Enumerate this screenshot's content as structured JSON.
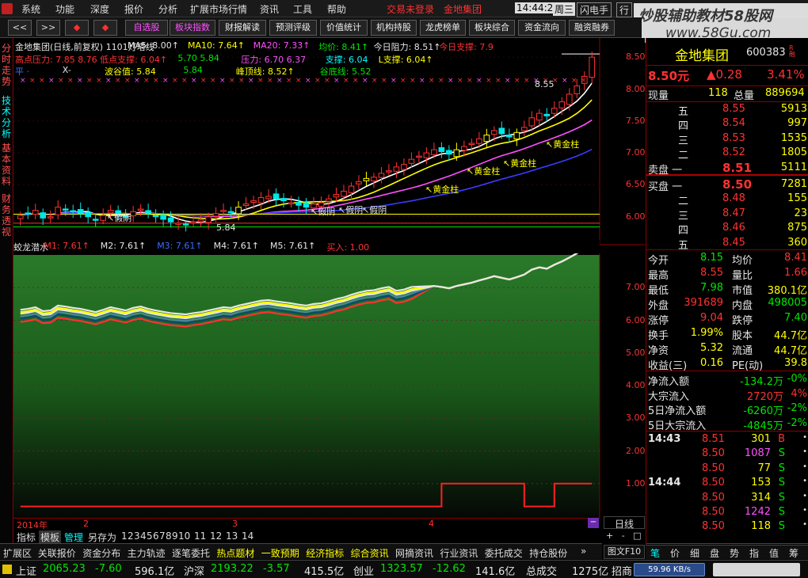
{
  "menu": [
    "系统",
    "功能",
    "深度",
    "报价",
    "分析",
    "扩展市场行情",
    "资讯",
    "工具",
    "帮助"
  ],
  "menu_status": {
    "login": "交易未登录",
    "stock": "金地集团",
    "clock": "14:44:29",
    "weekday": "周三",
    "flash": "闪电手",
    "more": "行"
  },
  "watermark": {
    "title": "炒股辅助教材58股网",
    "url": "www.58Gu.com"
  },
  "nav_buttons": [
    "<<",
    ">>",
    "◆",
    "◆"
  ],
  "toolbar": [
    "自选股",
    "板块指数",
    "财报解读",
    "预测评级",
    "价值统计",
    "机构持股",
    "龙虎榜单",
    "板块综合",
    "资金流向",
    "融资融券"
  ],
  "side_tabs": [
    "分时走势",
    "技术分析",
    "基本资料",
    "财务透视"
  ],
  "main_chart": {
    "header": [
      {
        "t": "金地集团(日线,前复权) 1101灯塔线",
        "c": "#e6e6e6"
      },
      {
        "t": "MA5: 8.00↑",
        "c": "#e6e6e6"
      },
      {
        "t": "MA10: 7.64↑",
        "c": "#ffff00"
      },
      {
        "t": "MA20: 7.33↑",
        "c": "#ff50ff"
      },
      {
        "t": "均价: 8.41↑",
        "c": "#00e600"
      },
      {
        "t": "今日阻力: 8.51↑",
        "c": "#e6e6e6"
      },
      {
        "t": "今日支撑: 7.9",
        "c": "#ff3232"
      }
    ],
    "header2": [
      {
        "t": "高点压力: 7.85  8.76  低点支撑: 6.04↑",
        "c": "#ff3232"
      },
      {
        "t": "5.70  5.84",
        "c": "#00e600"
      },
      {
        "t": "压力: 6.70  6.37",
        "c": "#ff50ff"
      },
      {
        "t": "支撑: 6.04",
        "c": "#00ffff"
      },
      {
        "t": "L支撑: 6.04↑",
        "c": "#ffff00"
      }
    ],
    "header3": [
      {
        "t": "平 ·",
        "c": "#3b6cff"
      },
      {
        "t": "X-",
        "c": "#e6e6e6"
      },
      {
        "t": "波谷值: 5.84",
        "c": "#ffff00"
      },
      {
        "t": "5.84",
        "c": "#00e600"
      },
      {
        "t": "峰顶线: 8.52↑",
        "c": "#ffff00"
      },
      {
        "t": "谷底线: 5.52",
        "c": "#00e600"
      }
    ],
    "y_labels": [
      "8.50",
      "8.00",
      "7.50",
      "7.00",
      "6.50",
      "6.00"
    ],
    "annotations": [
      "黄金柱",
      "黄金柱",
      "黄金柱",
      "黄金柱",
      "假阴",
      "假阴",
      "假阴",
      "假阴",
      "8.55",
      "5.84"
    ]
  },
  "sub_chart": {
    "header": [
      {
        "t": "蛟龙潜水",
        "c": "#e6e6e6"
      },
      {
        "t": "M1: 7.61↑",
        "c": "#ff3232"
      },
      {
        "t": "M2: 7.61↑",
        "c": "#e6e6e6"
      },
      {
        "t": "M3: 7.61↑",
        "c": "#3b6cff"
      },
      {
        "t": "M4: 7.61↑",
        "c": "#e6e6e6"
      },
      {
        "t": "M5: 7.61↑",
        "c": "#e6e6e6"
      },
      {
        "t": "买入: 1.00",
        "c": "#ff3232"
      }
    ],
    "y_labels": [
      "7.00",
      "6.00",
      "5.00",
      "4.00",
      "3.00",
      "2.00",
      "1.00"
    ]
  },
  "x_axis": [
    "2014年",
    "2",
    "3",
    "4"
  ],
  "period_label": "日线",
  "chart_tabs": [
    "指标",
    "模板",
    "管理",
    "另存为",
    "1",
    "2",
    "3",
    "4",
    "5",
    "6",
    "7",
    "8",
    "9",
    "10",
    "11",
    "12",
    "13",
    "14"
  ],
  "quote": {
    "name": "金地集团",
    "code": "600383",
    "price": "8.50元",
    "change": "▲0.28",
    "pct": "3.41%",
    "now_vol_label": "现量",
    "now_vol": "118",
    "total_label": "总量",
    "total": "889694",
    "asks": [
      {
        "l": "五",
        "p": "8.55",
        "v": "5913"
      },
      {
        "l": "四",
        "p": "8.54",
        "v": "997"
      },
      {
        "l": "三",
        "p": "8.53",
        "v": "1535"
      },
      {
        "l": "二",
        "p": "8.52",
        "v": "1805"
      },
      {
        "l": "卖盘 一",
        "p": "8.51",
        "v": "5111"
      }
    ],
    "bids": [
      {
        "l": "买盘 一",
        "p": "8.50",
        "v": "7281"
      },
      {
        "l": "二",
        "p": "8.48",
        "v": "155"
      },
      {
        "l": "三",
        "p": "8.47",
        "v": "23"
      },
      {
        "l": "四",
        "p": "8.46",
        "v": "875"
      },
      {
        "l": "五",
        "p": "8.45",
        "v": "360"
      }
    ],
    "stats": [
      {
        "a": "今开",
        "b": "8.15",
        "c": "均价",
        "d": "8.41",
        "bc": "#00e600",
        "dc": "#ff3232"
      },
      {
        "a": "最高",
        "b": "8.55",
        "c": "量比",
        "d": "1.66",
        "bc": "#ff3232",
        "dc": "#ff3232"
      },
      {
        "a": "最低",
        "b": "7.98",
        "c": "市值",
        "d": "380.1亿",
        "bc": "#00e600",
        "dc": "#ffff00"
      },
      {
        "a": "外盘",
        "b": "391689",
        "c": "内盘",
        "d": "498005",
        "bc": "#ff3232",
        "dc": "#00e600"
      },
      {
        "a": "涨停",
        "b": "9.04",
        "c": "跌停",
        "d": "7.40",
        "bc": "#ff3232",
        "dc": "#00e600"
      },
      {
        "a": "换手",
        "b": "1.99%",
        "c": "股本",
        "d": "44.7亿",
        "bc": "#ffff00",
        "dc": "#ffff00"
      },
      {
        "a": "净资",
        "b": "5.32",
        "c": "流通",
        "d": "44.7亿",
        "bc": "#ffff00",
        "dc": "#ffff00"
      },
      {
        "a": "收益(三)",
        "b": "0.16",
        "c": "PE(动)",
        "d": "39.8",
        "bc": "#ffff00",
        "dc": "#ffff00"
      }
    ],
    "flows": [
      {
        "a": "净流入额",
        "b": "-134.2万",
        "c": "-0%"
      },
      {
        "a": "大宗流入",
        "b": "2720万",
        "c": "4%"
      },
      {
        "a": "5日净流入额",
        "b": "-6260万",
        "c": "-2%"
      },
      {
        "a": "5日大宗流入",
        "b": "-4845万",
        "c": "-2%"
      }
    ],
    "ticks": [
      {
        "t": "14:43",
        "p": "8.51",
        "v": "301",
        "s": "B",
        "vc": "#ffff00",
        "sc": "#ff3232"
      },
      {
        "t": "",
        "p": "8.50",
        "v": "1087",
        "s": "S",
        "vc": "#ff50ff",
        "sc": "#00e600"
      },
      {
        "t": "",
        "p": "8.50",
        "v": "77",
        "s": "S",
        "vc": "#ffff00",
        "sc": "#00e600"
      },
      {
        "t": "14:44",
        "p": "8.50",
        "v": "153",
        "s": "S",
        "vc": "#ffff00",
        "sc": "#00e600"
      },
      {
        "t": "",
        "p": "8.50",
        "v": "314",
        "s": "S",
        "vc": "#ffff00",
        "sc": "#00e600"
      },
      {
        "t": "",
        "p": "8.50",
        "v": "1242",
        "s": "S",
        "vc": "#ff50ff",
        "sc": "#00e600"
      },
      {
        "t": "",
        "p": "8.50",
        "v": "118",
        "s": "S",
        "vc": "#ffff00",
        "sc": "#00e600"
      }
    ],
    "bottom_tabs": [
      "笔",
      "价",
      "细",
      "盘",
      "势",
      "指",
      "值",
      "筹"
    ]
  },
  "bottom_tabs": [
    "扩展区",
    "关联报价",
    "资金分布",
    "主力轨迹",
    "逐笔委托",
    "热点题材",
    "一致预期",
    "经济指标",
    "综合资讯",
    "网摘资讯",
    "行业资讯",
    "委托成交",
    "持仓股份"
  ],
  "bottom_right": [
    "图文F10"
  ],
  "status": {
    "sh_label": "上证",
    "sh": "2065.23",
    "sh_chg": "-7.60",
    "sh_amt": "596.1亿",
    "hs_label": "沪深",
    "hs": "2193.22",
    "hs_chg": "-3.57",
    "hs_amt": "415.5亿",
    "cy_label": "创业",
    "cy": "1323.57",
    "cy_chg": "-12.62",
    "cy_amt": "141.6亿",
    "total_label": "总成交",
    "total": "1275亿",
    "extra": "招商",
    "speed": "59.96 KB/s"
  }
}
